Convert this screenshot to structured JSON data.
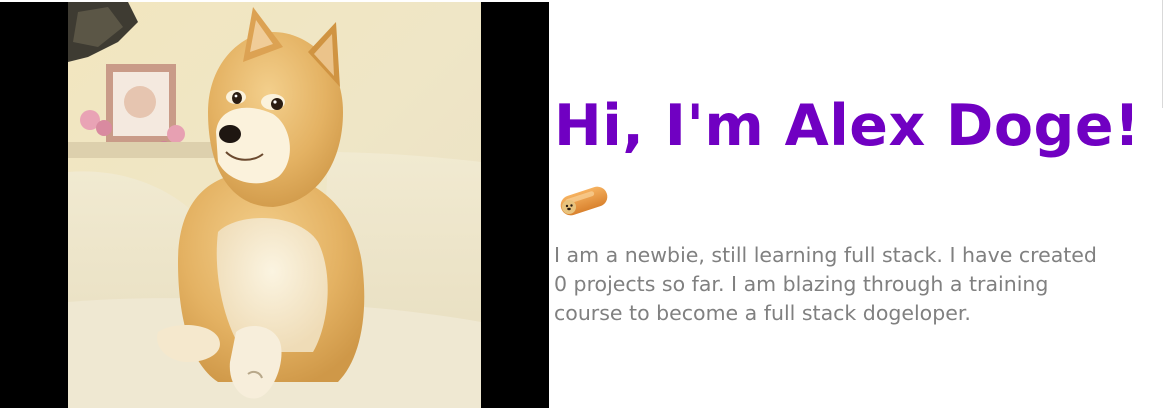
{
  "hero": {
    "photo_alt": "Shiba Inu doge",
    "headline": "Hi, I'm Alex Doge!",
    "sticker_icon": "hotdoge-icon",
    "bio": "I am a newbie, still learning full stack. I have created 0 projects so far. I am blazing through a training course to become a full stack dogeloper."
  },
  "colors": {
    "headline": "#7000c2",
    "bio_text": "#808080",
    "photo_backdrop": "#000000"
  }
}
